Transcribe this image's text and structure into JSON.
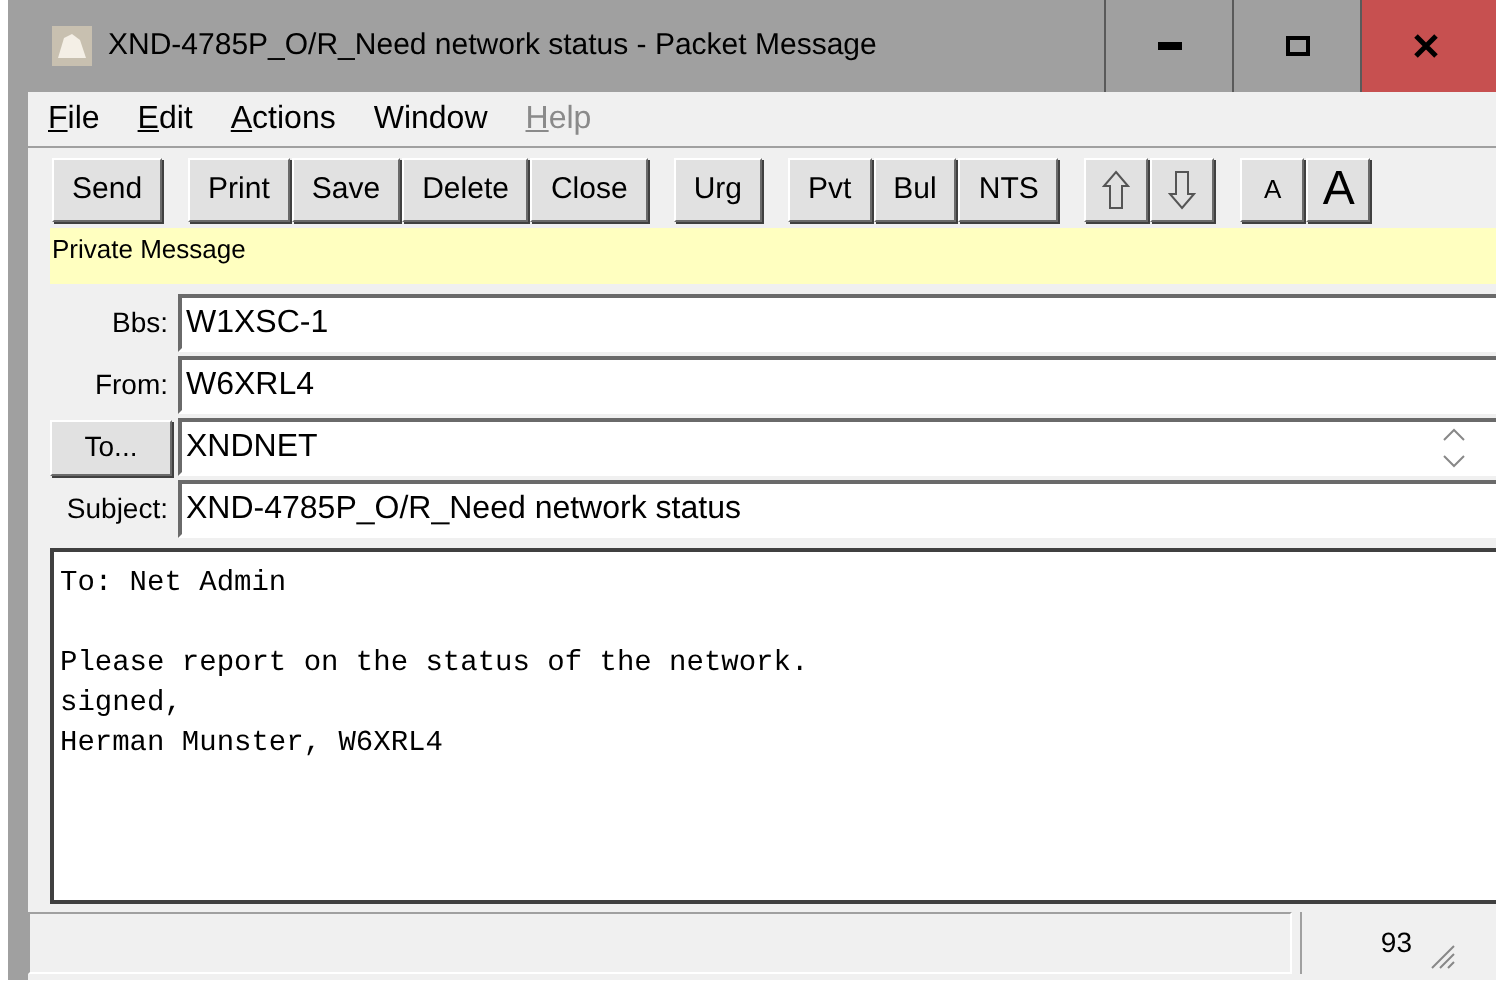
{
  "window": {
    "title": "XND-4785P_O/R_Need network status - Packet Message"
  },
  "menu": [
    {
      "label": "File",
      "mnemonic": true,
      "disabled": false
    },
    {
      "label": "Edit",
      "mnemonic": true,
      "disabled": false
    },
    {
      "label": "Actions",
      "mnemonic": true,
      "disabled": false
    },
    {
      "label": "Window",
      "mnemonic": false,
      "disabled": false
    },
    {
      "label": "Help",
      "mnemonic": true,
      "disabled": true
    }
  ],
  "toolbar_groups": [
    [
      {
        "kind": "text",
        "label": "Send"
      }
    ],
    [
      {
        "kind": "text",
        "label": "Print"
      },
      {
        "kind": "text",
        "label": "Save"
      },
      {
        "kind": "text",
        "label": "Delete"
      },
      {
        "kind": "text",
        "label": "Close"
      }
    ],
    [
      {
        "kind": "text",
        "label": "Urg"
      }
    ],
    [
      {
        "kind": "text",
        "label": "Pvt"
      },
      {
        "kind": "text",
        "label": "Bul"
      },
      {
        "kind": "text",
        "label": "NTS"
      }
    ],
    [
      {
        "kind": "up"
      },
      {
        "kind": "down"
      }
    ],
    [
      {
        "kind": "small",
        "label": "A"
      },
      {
        "kind": "large",
        "label": "A"
      }
    ]
  ],
  "banner": "Private Message",
  "fields": [
    {
      "kind": "label",
      "label": "Bbs:",
      "value": "W1XSC-1"
    },
    {
      "kind": "label",
      "label": "From:",
      "value": "W6XRL4"
    },
    {
      "kind": "button",
      "label": "To...",
      "value": "XNDNET"
    },
    {
      "kind": "label",
      "label": "Subject:",
      "value": "XND-4785P_O/R_Need network status"
    }
  ],
  "body": "To: Net Admin\n\nPlease report on the status of the network.\nsigned,\nHerman Munster, W6XRL4",
  "status_bar": {
    "count": "93"
  }
}
